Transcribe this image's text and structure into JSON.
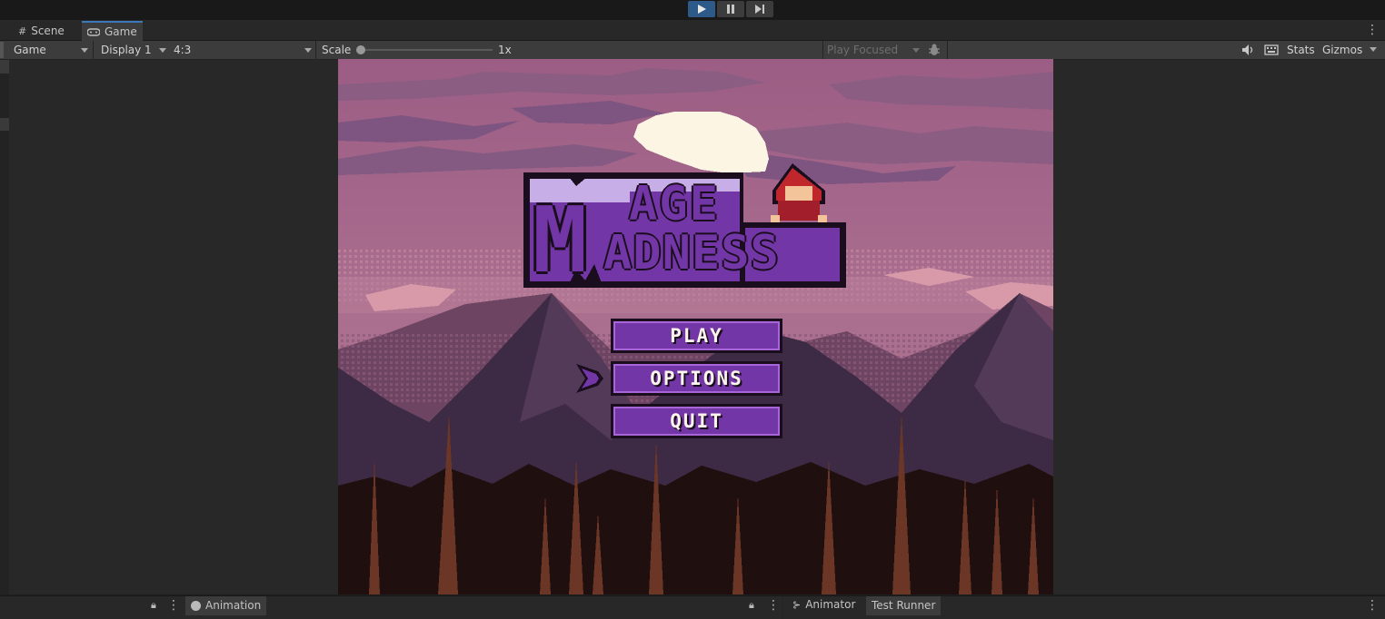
{
  "toolbar_top": {
    "play_icon": "play-icon",
    "pause_icon": "pause-icon",
    "step_icon": "step-icon"
  },
  "tabs": [
    {
      "label": "Scene",
      "icon": "grid-icon"
    },
    {
      "label": "Game",
      "icon": "gamepad-icon"
    }
  ],
  "game_toolbar": {
    "view_select": "Game",
    "display_select": "Display 1",
    "aspect_select": "4:3",
    "scale_label": "Scale",
    "scale_value": "1x",
    "play_mode_select": "Play Focused",
    "stats_label": "Stats",
    "gizmos_label": "Gizmos"
  },
  "game": {
    "title_line1": "AGE",
    "title_line2": "ADNESS",
    "buttons": [
      "PLAY",
      "OPTIONS",
      "QUIT"
    ],
    "selected_index": 1,
    "colors": {
      "sky": "#a5688d",
      "moon": "#fdf5e4",
      "logo_purple": "#7336a6",
      "logo_light": "#c8aee6",
      "mountain": "#3d2a44",
      "forest": "#1f0f0f",
      "tree": "#6b3626"
    }
  },
  "bottom_panels": {
    "animation_tab": "Animation",
    "animator_tab": "Animator",
    "test_runner_tab": "Test Runner"
  }
}
